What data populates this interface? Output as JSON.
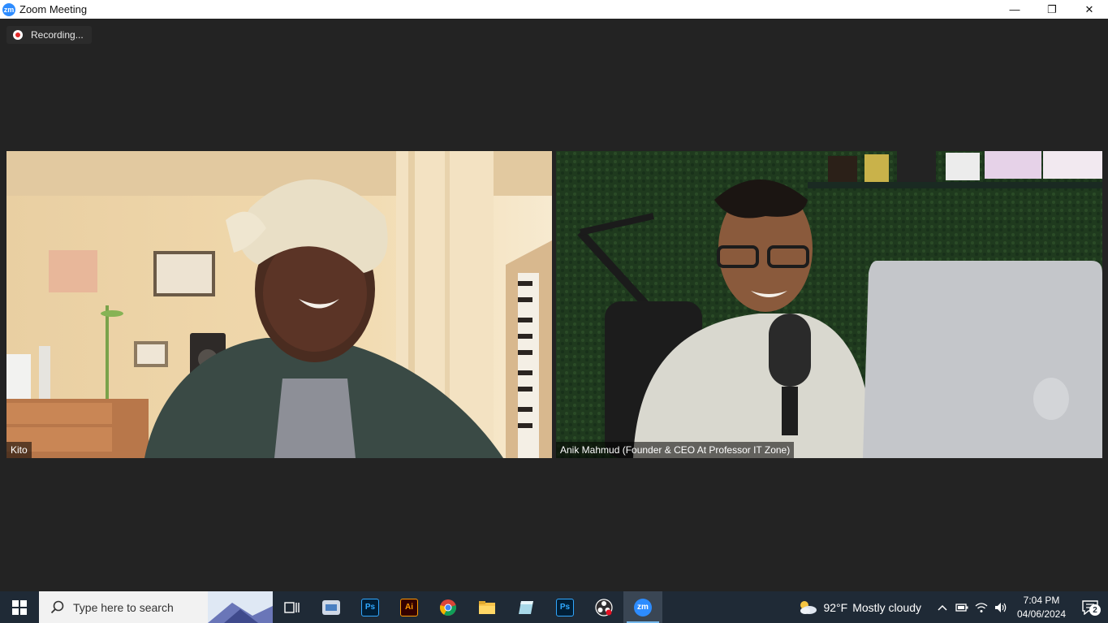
{
  "window": {
    "title": "Zoom Meeting",
    "logo_text": "zm",
    "controls": {
      "minimize": "—",
      "restore": "❐",
      "close": "✕"
    }
  },
  "recording": {
    "label": "Recording..."
  },
  "participants": [
    {
      "name": "Kito"
    },
    {
      "name": "Anik Mahmud (Founder & CEO At Professor IT Zone)"
    }
  ],
  "taskbar": {
    "search_placeholder": "Type here to search",
    "apps": [
      {
        "icon": "task-view-icon"
      },
      {
        "icon": "network-app-icon"
      },
      {
        "icon": "photoshop-icon",
        "text": "Ps"
      },
      {
        "icon": "illustrator-icon",
        "text": "Ai"
      },
      {
        "icon": "chrome-icon"
      },
      {
        "icon": "file-explorer-icon"
      },
      {
        "icon": "notes-app-icon"
      },
      {
        "icon": "photoshop-icon",
        "text": "Ps"
      },
      {
        "icon": "obs-icon"
      },
      {
        "icon": "zoom-icon",
        "text": "zm",
        "active": true
      }
    ],
    "weather": {
      "temp": "92°F",
      "condition": "Mostly cloudy"
    },
    "clock": {
      "time": "7:04 PM",
      "date": "04/06/2024"
    },
    "notifications_count": "2"
  },
  "colors": {
    "zoom_blue": "#2d8cff",
    "stage_bg": "#232323",
    "taskbar_bg": "#1f2a36",
    "recording_red": "#e02828",
    "photoshop": "#31a8ff",
    "illustrator": "#ff9a00"
  }
}
